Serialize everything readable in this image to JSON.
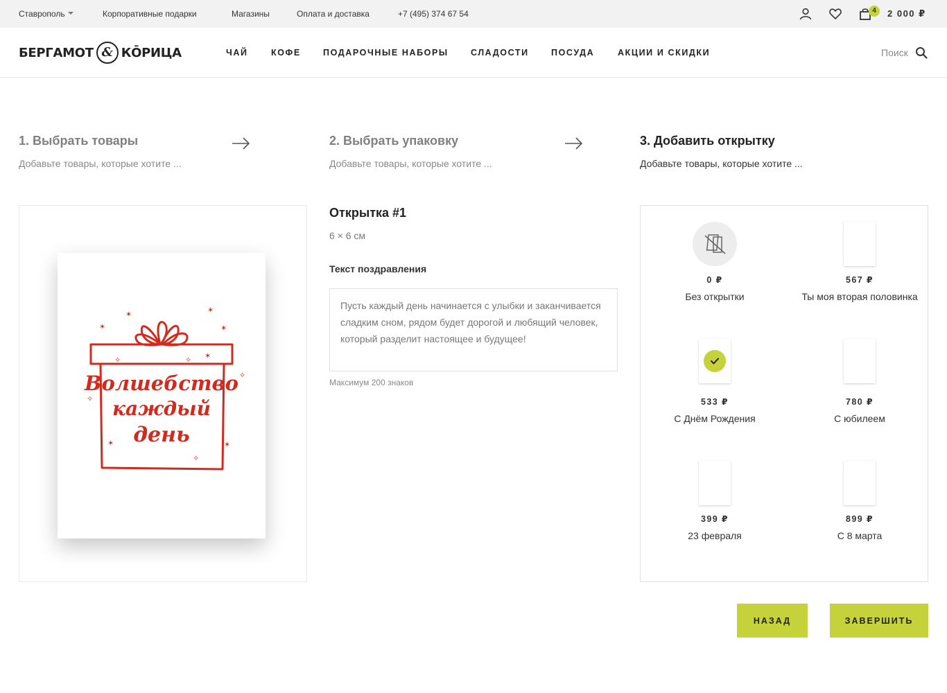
{
  "topbar": {
    "city": "Ставрополь",
    "links": [
      "Корпоративные подарки",
      "Магазины",
      "Оплата и доставка"
    ],
    "phone": "+7 (495) 374 67 54",
    "cart_count": "4",
    "cart_total": "2 000 ₽"
  },
  "header": {
    "logo_left": "БЕРГАМОТ",
    "logo_amp": "&",
    "logo_right": "КŌРИЦА",
    "nav": [
      "ЧАЙ",
      "КОФЕ",
      "ПОДАРОЧНЫЕ НАБОРЫ",
      "СЛАДОСТИ",
      "ПОСУДА",
      "АКЦИИ И СКИДКИ"
    ],
    "search_label": "Поиск"
  },
  "steps": [
    {
      "title": "1. Выбрать товары",
      "subtitle": "Добавьте товары, которые хотите ..."
    },
    {
      "title": "2. Выбрать упаковку",
      "subtitle": "Добавьте товары, которые хотите ..."
    },
    {
      "title": "3. Добавить открытку",
      "subtitle": "Добавьте товары, которые хотите ..."
    }
  ],
  "preview": {
    "card_lines": [
      "Волшебство",
      "каждый",
      "день"
    ]
  },
  "card_detail": {
    "title": "Открытка #1",
    "size": "6 × 6 см",
    "text_label": "Текст поздравления",
    "text_value": "Пусть каждый день начинается с улыбки и заканчивается сладким сном, рядом будет дорогой и любящий человек, который разделит настоящее и будущее!",
    "hint": "Максимум 200 знаков"
  },
  "options": [
    {
      "price": "0 ₽",
      "name": "Без открытки",
      "selected": false
    },
    {
      "price": "567 ₽",
      "name": "Ты моя вторая половинка",
      "selected": false
    },
    {
      "price": "533 ₽",
      "name": "С Днём Рождения",
      "selected": true
    },
    {
      "price": "780 ₽",
      "name": "С юбилеем",
      "selected": false
    },
    {
      "price": "399 ₽",
      "name": "23 февраля",
      "selected": false
    },
    {
      "price": "899 ₽",
      "name": "С 8 марта",
      "selected": false
    }
  ],
  "buttons": {
    "back": "НАЗАД",
    "finish": "ЗАВЕРШИТЬ"
  },
  "colors": {
    "accent": "#c6d23a",
    "card_red": "#d32a1e",
    "topbar_bg": "#f2f2f2"
  },
  "icons": [
    "user-icon",
    "heart-icon",
    "bag-icon",
    "search-icon",
    "arrow-right-icon",
    "no-card-icon",
    "check-icon"
  ]
}
